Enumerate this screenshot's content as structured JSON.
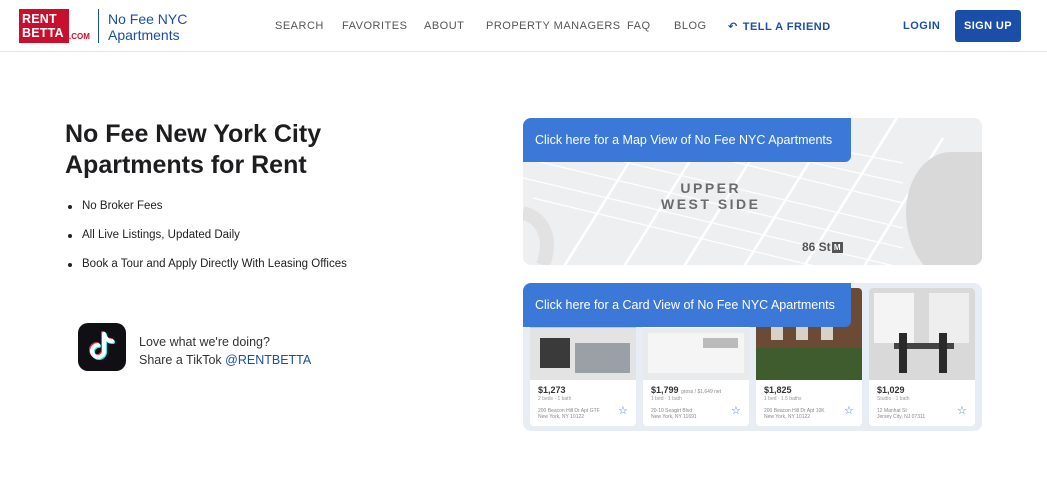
{
  "header": {
    "logo_line1": "RENT",
    "logo_line2": "BETTA",
    "logo_suffix": ".COM",
    "brand_line1": "No Fee NYC",
    "brand_line2": "Apartments",
    "nav": [
      "SEARCH",
      "FAVORITES",
      "ABOUT",
      "PROPERTY MANAGERS",
      "FAQ",
      "BLOG"
    ],
    "tell_friend": "TELL A FRIEND",
    "login": "LOGIN",
    "signup": "SIGN UP"
  },
  "hero": {
    "title": "No Fee New York City Apartments for Rent",
    "bullets": [
      "No Broker Fees",
      "All Live Listings, Updated Daily",
      "Book a Tour and Apply Directly With Leasing Offices"
    ]
  },
  "tiktok": {
    "line1": "Love what we're doing?",
    "line2_prefix": "Share a TikTok ",
    "handle": "@RENTBETTA"
  },
  "map_view": {
    "button": "Click here for a Map View of No Fee NYC Apartments",
    "neighborhood_line1": "UPPER",
    "neighborhood_line2": "WEST SIDE",
    "station": "86 St",
    "station_badge": "M"
  },
  "card_view": {
    "button": "Click here for a Card View of No Fee NYC Apartments",
    "listings": [
      {
        "price": "$1,273",
        "price_note": "",
        "beds": "2 beds · 1 bath",
        "addr1": "200 Beacon Hill Dr Apt GTF",
        "addr2": "New York, NY 10122"
      },
      {
        "price": "$1,799",
        "price_note": "gross / $1,649 net",
        "beds": "1 bed · 1 bath",
        "addr1": "20-10 Seagirt Blvd",
        "addr2": "New York, NY 11691"
      },
      {
        "price": "$1,825",
        "price_note": "",
        "beds": "1 bed · 1.5 baths",
        "addr1": "200 Beacon Hill Dr Apt 10K",
        "addr2": "New York, NY 10122"
      },
      {
        "price": "$1,029",
        "price_note": "",
        "beds": "Studio · 1 bath",
        "addr1": "12 Manhat St",
        "addr2": "Jersey City, NJ 07311"
      }
    ]
  }
}
